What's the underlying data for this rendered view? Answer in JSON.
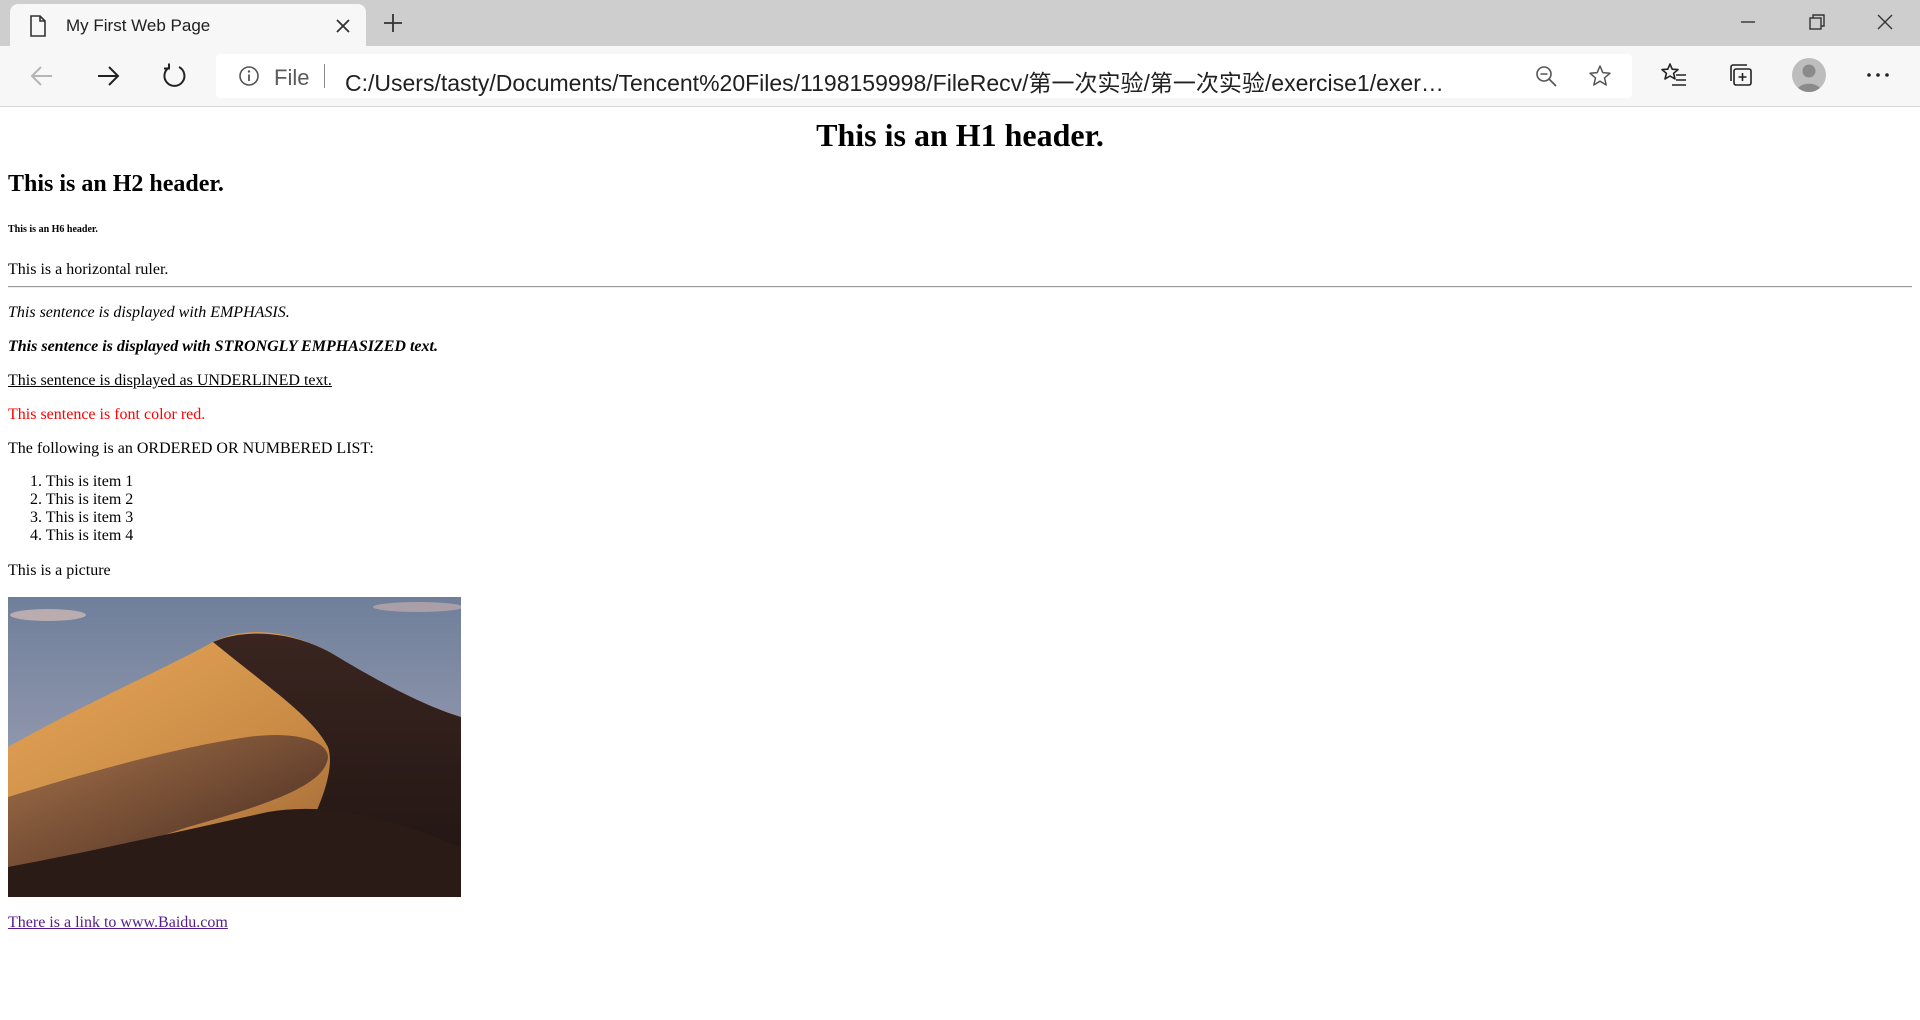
{
  "browser": {
    "tab_title": "My First Web Page",
    "address": {
      "scheme_label": "File",
      "url": "C:/Users/tasty/Documents/Tencent%20Files/1198159998/FileRecv/第一次实验/第一次实验/exercise1/exercis..."
    },
    "icons": {
      "tab": "page-icon",
      "close": "close-icon",
      "new_tab": "plus-icon",
      "minimize": "minimize-icon",
      "restore": "restore-icon",
      "window_close": "close-icon",
      "back": "back-arrow-icon",
      "forward": "forward-arrow-icon",
      "refresh": "refresh-icon",
      "info": "info-icon",
      "zoom": "zoom-out-icon",
      "favorite": "star-icon",
      "favorites": "favorites-list-icon",
      "collections": "collections-icon",
      "profile": "avatar",
      "more": "more-icon"
    }
  },
  "page": {
    "h1": "This is an H1 header.",
    "h2": "This is an H2 header.",
    "h6": "This is an H6 header.",
    "ruler_text": "This is a horizontal ruler.",
    "emphasis": "This sentence is displayed with EMPHASIS.",
    "strong": "This sentence is displayed with STRONGLY EMPHASIZED text.",
    "underlined": "This sentence is displayed as UNDERLINED text.",
    "red": "This sentence is font color red.",
    "list_intro": "The following is an ORDERED OR NUMBERED LIST:",
    "list_items": [
      "1. This is item 1",
      "2. This is item 2",
      "3. This is item 3",
      "4. This is item 4"
    ],
    "picture_label": "This is a picture",
    "picture_subject": "desert sand dune at dusk",
    "link": "There is a link to www.Baidu.com",
    "colors": {
      "red_text": "#ff0000",
      "visited_link": "#551a8b"
    }
  }
}
